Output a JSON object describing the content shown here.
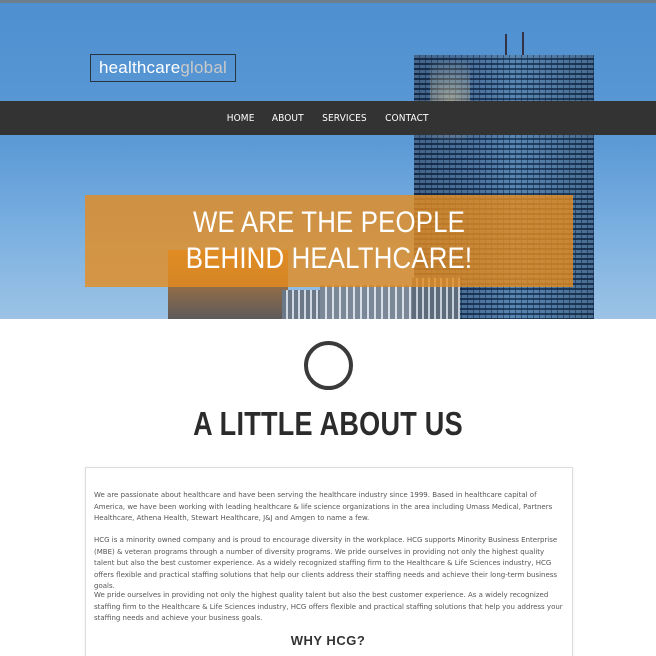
{
  "logo": {
    "part1": "healthcare",
    "part2": "global"
  },
  "nav": {
    "items": [
      {
        "label": "HOME"
      },
      {
        "label": "ABOUT"
      },
      {
        "label": "SERVICES"
      },
      {
        "label": "CONTACT"
      }
    ]
  },
  "hero": {
    "headline": "WE ARE THE PEOPLE BEHIND HEALTHCARE!"
  },
  "about": {
    "title": "A LITTLE ABOUT US",
    "paragraphs": [
      "We are passionate about healthcare and have been serving the healthcare industry since 1999. Based in healthcare capital of America, we have been working with leading healthcare & life science organizations in the area including Umass Medical, Partners Healthcare, Athena Health, Stewart Healthcare, J&J and Amgen to name a few.",
      "HCG is a minority owned company and is proud to encourage diversity in the workplace. HCG supports Minority Business Enterprise (MBE) & veteran programs through a number of diversity programs. We pride ourselves in providing not only the highest quality talent but also the best customer experience. As a widely recognized staffing firm to the Healthcare & Life Sciences industry, HCG offers flexible and practical staffing solutions that help our clients address their staffing needs and achieve their long-term business goals.",
      "We pride ourselves in providing not only the highest quality talent but also the best customer experience. As a widely recognized staffing firm to the Healthcare & Life Sciences industry, HCG offers flexible and practical staffing solutions that help you address your staffing needs and achieve your business goals."
    ],
    "why_heading": "WHY HCG?"
  },
  "colors": {
    "nav_bg": "#333333",
    "banner_bg": "#e68c1e",
    "title_text": "#2b2b2b",
    "body_text": "#555555"
  }
}
